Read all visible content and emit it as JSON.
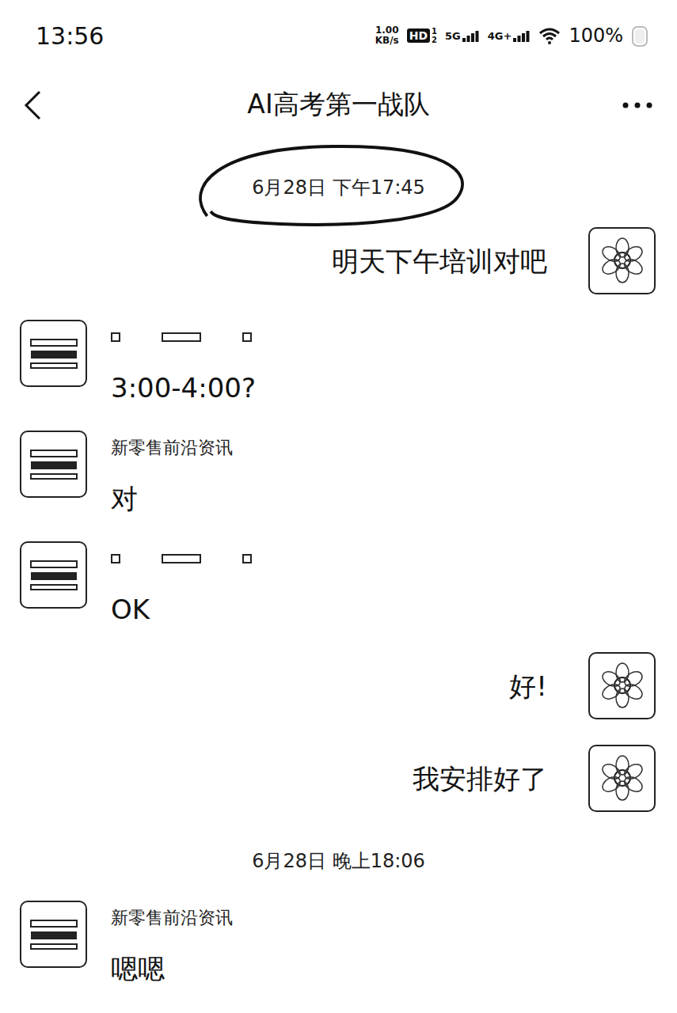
{
  "status_bar": {
    "time": "13:56",
    "speed_value": "1.00",
    "speed_unit": "KB/s",
    "hd": "HD",
    "sim_slots": [
      "1",
      "2"
    ],
    "networks": [
      {
        "label": "5G",
        "signal": 1
      },
      {
        "label": "4G+",
        "signal": 1
      }
    ],
    "battery": "100%",
    "battery_level": 1
  },
  "header": {
    "title": "AI高考第一战队"
  },
  "messages": [
    {
      "kind": "timestamp",
      "text": "6月28日 下午17:45",
      "circled": true
    },
    {
      "kind": "outgoing",
      "text": "明天下午培训对吧"
    },
    {
      "kind": "incoming",
      "sender_redacted": true,
      "text": "3:00-4:00?"
    },
    {
      "kind": "incoming",
      "sender": "新零售前沿资讯",
      "sender_redacted": false,
      "text": "对"
    },
    {
      "kind": "incoming",
      "sender_redacted": true,
      "text": "OK"
    },
    {
      "kind": "outgoing",
      "text": "好!"
    },
    {
      "kind": "outgoing",
      "text": "我安排好了"
    },
    {
      "kind": "timestamp",
      "text": "6月28日 晚上18:06",
      "circled": false
    },
    {
      "kind": "incoming",
      "sender": "新零售前沿资讯",
      "sender_redacted": false,
      "text": "嗯嗯"
    }
  ]
}
